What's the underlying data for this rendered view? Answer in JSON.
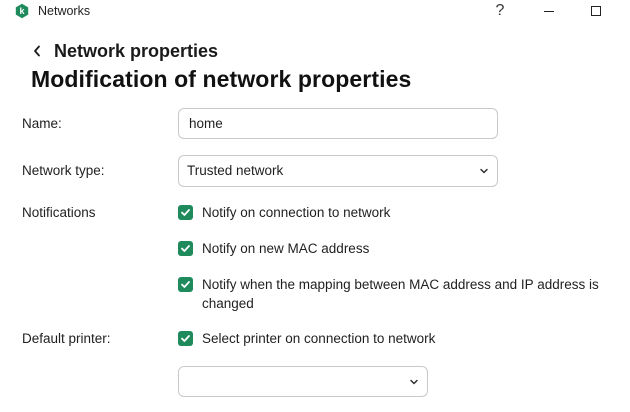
{
  "window": {
    "title": "Networks",
    "help_label": "?"
  },
  "header": {
    "breadcrumb": "Network properties",
    "title": "Modification of network properties"
  },
  "form": {
    "name": {
      "label": "Name:",
      "value": "home"
    },
    "network_type": {
      "label": "Network type:",
      "selected": "Trusted network"
    },
    "notifications": {
      "label": "Notifications",
      "options": [
        {
          "label": "Notify on connection to network",
          "checked": true
        },
        {
          "label": "Notify on new MAC address",
          "checked": true
        },
        {
          "label": "Notify when the mapping between MAC address and IP address is changed",
          "checked": true
        }
      ]
    },
    "default_printer": {
      "label": "Default printer:",
      "option_label": "Select printer on connection to network",
      "checked": true,
      "selected": ""
    }
  },
  "colors": {
    "accent": "#1f8a5c"
  }
}
